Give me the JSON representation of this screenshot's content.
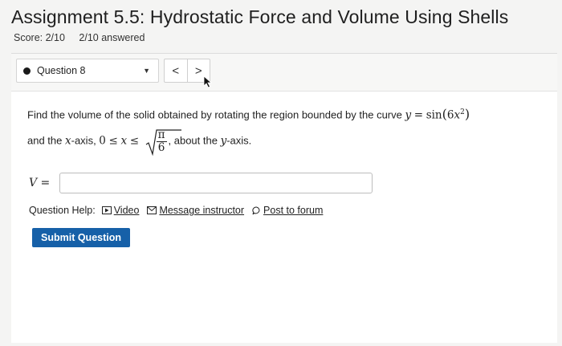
{
  "header": {
    "title": "Assignment 5.5: Hydrostatic Force and Volume Using Shells",
    "score": "Score: 2/10",
    "answered": "2/10 answered"
  },
  "question_nav": {
    "current": "Question 8",
    "prev_symbol": "<",
    "next_symbol": ">"
  },
  "question": {
    "line1_text": "Find the volume of the solid obtained by rotating the region bounded by the curve ",
    "curve_y": "y",
    "curve_eq": "=",
    "curve_sin": "sin",
    "curve_arg_open": "(",
    "curve_coef": "6",
    "curve_var": "x",
    "curve_exp": "2",
    "curve_arg_close": ")",
    "line2_text": "and the ",
    "axis_var": "x",
    "axis_text": "-axis, ",
    "bound_low": "0",
    "leq": "≤",
    "bound_var": "x",
    "frac_num": "π",
    "frac_den": "6",
    "after_text": ", about the ",
    "rot_var": "y",
    "rot_text": "-axis."
  },
  "answer": {
    "label": "V =",
    "value": "",
    "placeholder": ""
  },
  "help": {
    "label": "Question Help:",
    "video": "Video",
    "message": "Message instructor",
    "forum": "Post to forum"
  },
  "submit_label": "Submit Question"
}
